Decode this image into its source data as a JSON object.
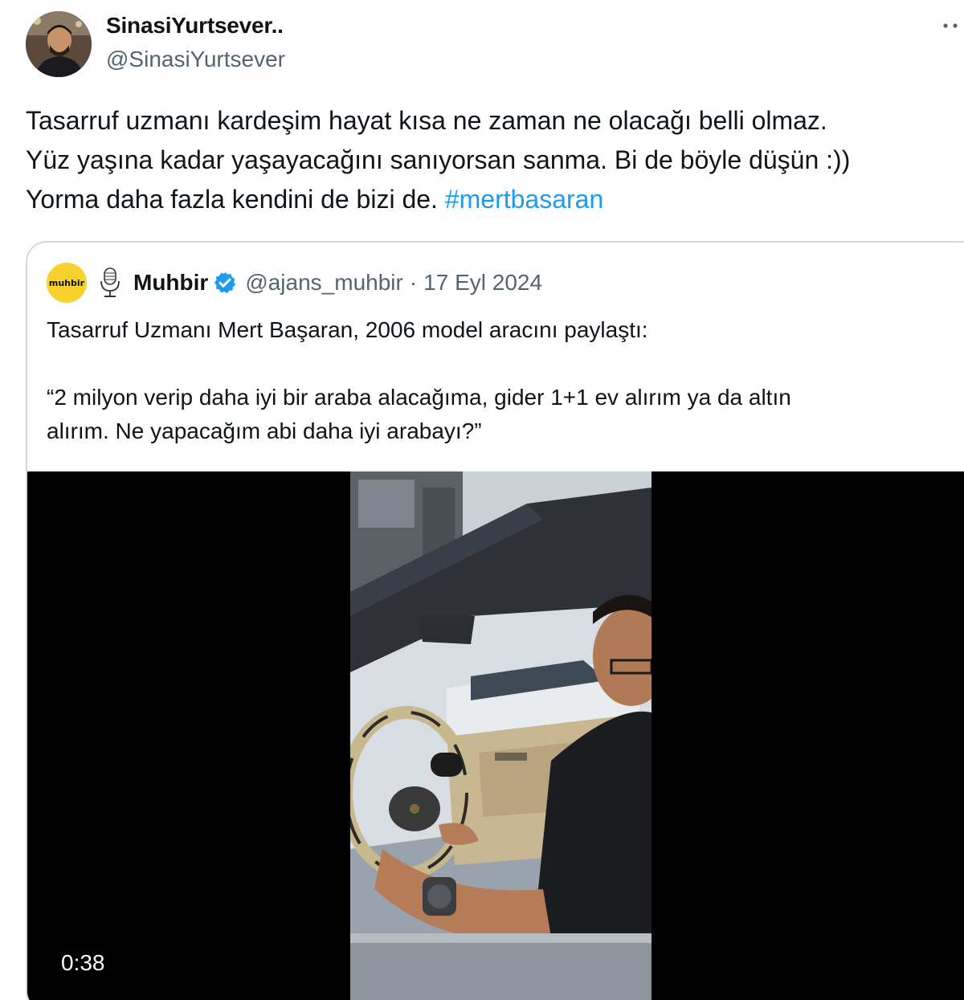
{
  "author": {
    "name": "SinasiYurtsever..",
    "handle": "@SinasiYurtsever"
  },
  "tweet": {
    "lines": [
      "Tasarruf uzmanı kardeşim hayat kısa ne zaman ne olacağı belli olmaz.",
      "Yüz yaşına kadar yaşayacağını sanıyorsan sanma. Bi de böyle düşün :))",
      "Yorma daha fazla kendini de bizi de."
    ],
    "hashtag": "#mertbasaran"
  },
  "quote": {
    "logo_text": "muhbir",
    "name": "Muhbir",
    "handle": "@ajans_muhbir",
    "separator": "·",
    "date": "17 Eyl 2024",
    "text_line1": "Tasarruf Uzmanı Mert Başaran, 2006 model aracını paylaştı:",
    "text_line2": "“2 milyon verip daha iyi bir araba alacağıma, gider 1+1 ev alırım ya da altın",
    "text_line3": "alırım. Ne yapacağım abi daha iyi arabayı?”",
    "video_duration": "0:38"
  },
  "icons": {
    "more": "more-dots-icon",
    "mic": "microphone-icon",
    "verified": "verified-badge-icon"
  },
  "colors": {
    "link": "#1d9bf0",
    "secondary_text": "#536471",
    "border": "#cfd9de",
    "logo_bg": "#f6d22a"
  }
}
